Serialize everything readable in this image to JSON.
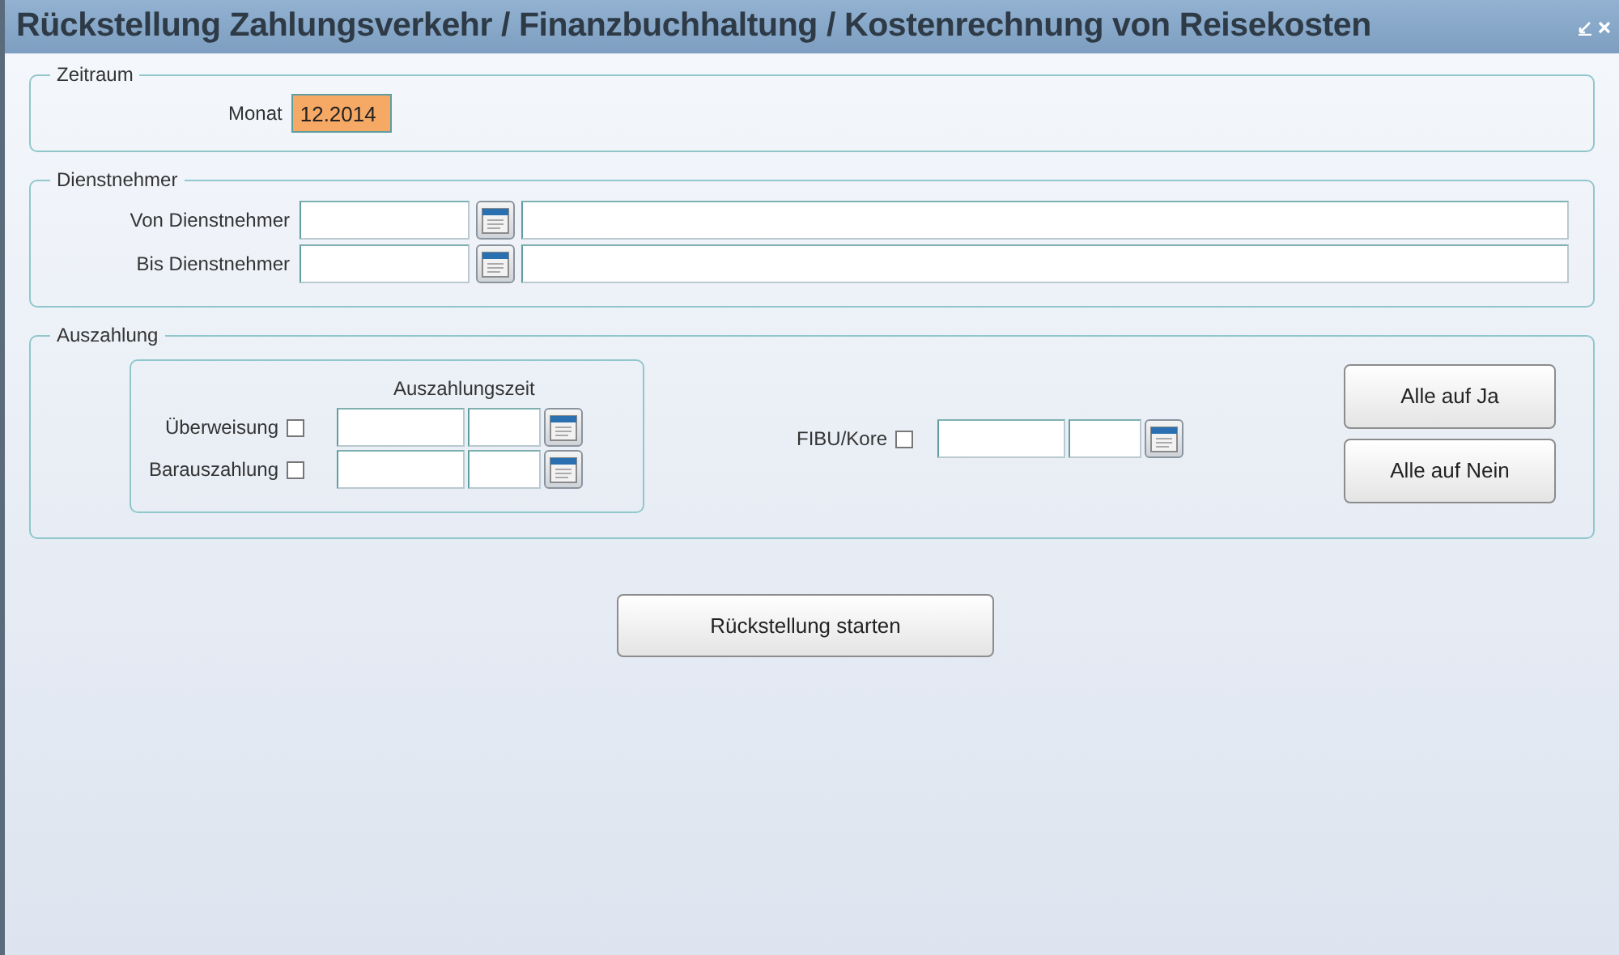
{
  "window": {
    "title": "Rückstellung Zahlungsverkehr / Finanzbuchhaltung / Kostenrechnung von Reisekosten"
  },
  "zeitraum": {
    "legend": "Zeitraum",
    "label": "Monat",
    "value": "12.2014"
  },
  "dienstnehmer": {
    "legend": "Dienstnehmer",
    "rows": [
      {
        "label": "Von Dienstnehmer"
      },
      {
        "label": "Bis Dienstnehmer"
      }
    ]
  },
  "auszahlung": {
    "legend": "Auszahlung",
    "column_header": "Auszahlungszeit",
    "rows": [
      {
        "label": "Überweisung",
        "checked": false
      },
      {
        "label": "Barauszahlung",
        "checked": false
      }
    ],
    "fibu": {
      "label": "FIBU/Kore",
      "checked": false
    },
    "buttons": [
      "Alle auf Ja",
      "Alle auf Nein"
    ]
  },
  "start_button": "Rückstellung starten"
}
